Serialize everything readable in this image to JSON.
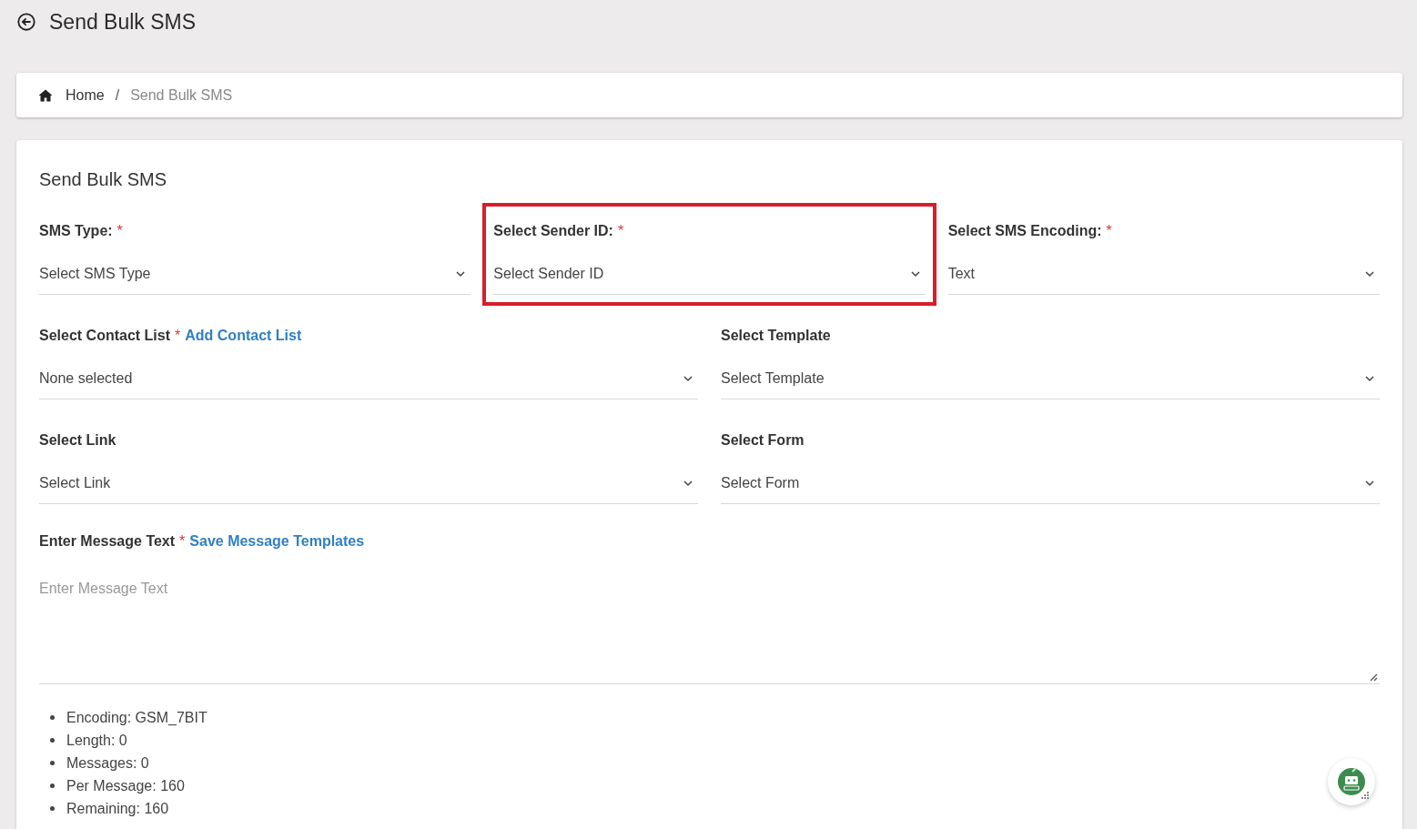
{
  "page_title": "Send Bulk SMS",
  "breadcrumb": [
    {
      "label": "Home",
      "kind": "home"
    },
    {
      "label": "Send Bulk SMS",
      "kind": "current",
      "separator": "/"
    }
  ],
  "card_title": "Send Bulk SMS",
  "rows": [
    {
      "fields": [
        {
          "label": "SMS Type:",
          "required_mark": "*",
          "value": "Select SMS Type",
          "highlighted": false
        },
        {
          "label": "Select Sender ID:",
          "required_mark": "*",
          "value": "Select Sender ID",
          "highlighted": true
        },
        {
          "label": "Select SMS Encoding:",
          "required_mark": "*",
          "value": "Text",
          "highlighted": false
        }
      ]
    },
    {
      "fields": [
        {
          "label": "Select Contact List",
          "required_mark": "*",
          "link": "Add Contact List",
          "value": "None selected",
          "highlighted": false
        },
        {
          "label": "Select Template",
          "value": "Select Template",
          "highlighted": false
        }
      ]
    },
    {
      "fields": [
        {
          "label": "Select Link",
          "value": "Select Link",
          "highlighted": false
        },
        {
          "label": "Select Form",
          "value": "Select Form",
          "highlighted": false
        }
      ]
    }
  ],
  "message": {
    "label": "Enter Message Text",
    "required_mark": "*",
    "link": "Save Message Templates",
    "placeholder": "Enter Message Text"
  },
  "stats": [
    "Encoding: GSM_7BIT",
    "Length: 0",
    "Messages: 0",
    "Per Message: 160",
    "Remaining: 160"
  ]
}
